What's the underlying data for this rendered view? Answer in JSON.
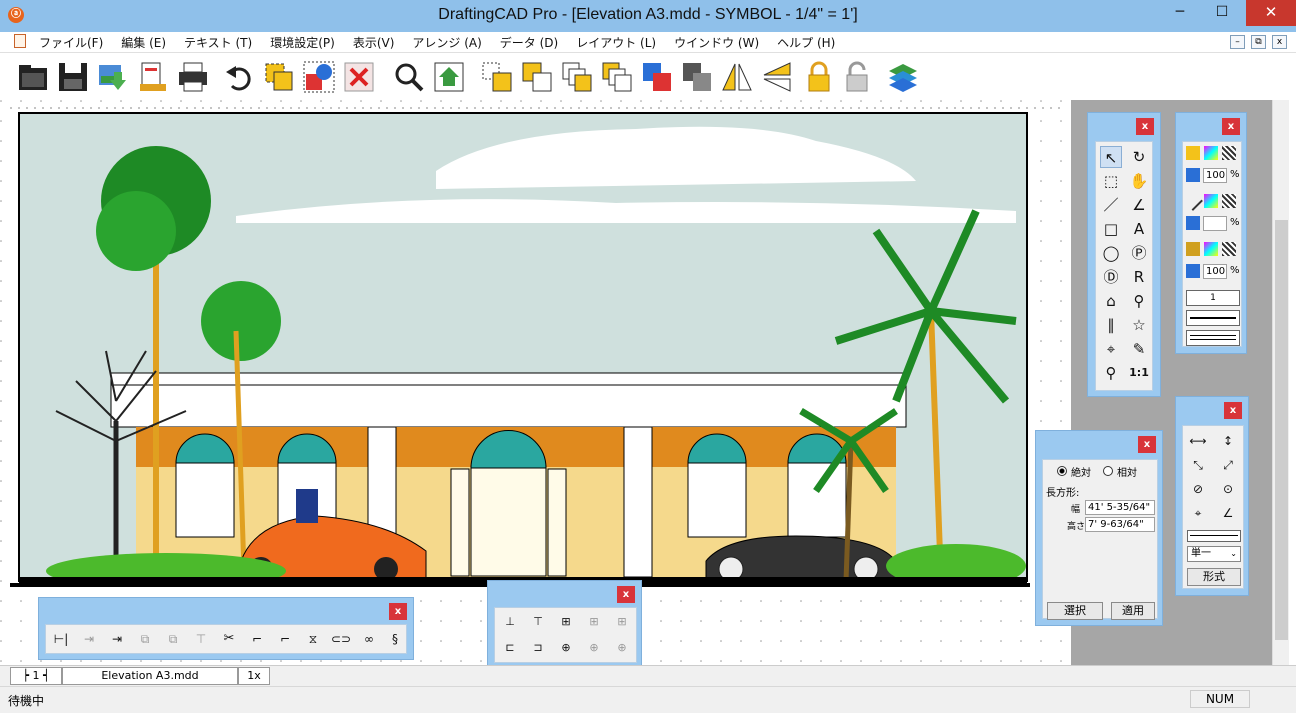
{
  "window": {
    "title": "DraftingCAD Pro - [Elevation A3.mdd - SYMBOL - 1/4\" = 1']",
    "app_icon": "ⓐ",
    "minimize": "─",
    "maximize": "☐",
    "close": "✕"
  },
  "menu": [
    "ファイル(F)",
    "編集 (E)",
    "テキスト (T)",
    "環境設定(P)",
    "表示(V)",
    "アレンジ (A)",
    "データ (D)",
    "レイアウト (L)",
    "ウインドウ (W)",
    "ヘルプ (H)"
  ],
  "mdi": {
    "min": "–",
    "restore": "⧉",
    "close": "x"
  },
  "toolbar_icons": [
    "open-icon",
    "save-icon",
    "export-image-icon",
    "print-preview-icon",
    "print-icon",
    "undo-icon",
    "group-icon",
    "ungroup-icon",
    "delete-icon",
    "zoom-icon",
    "home-view-icon",
    "bring-front-icon",
    "send-back-icon",
    "bring-forward-icon",
    "send-backward-icon",
    "combine-icon",
    "break-icon",
    "flip-horizontal-icon",
    "flip-vertical-icon",
    "lock-icon",
    "unlock-icon",
    "layers-icon"
  ],
  "tool_palette": {
    "close": "x",
    "tools": [
      "↖",
      "↻",
      "⬚",
      "✋",
      "／",
      "∠",
      "□",
      "A",
      "◯",
      "Ⓟ",
      "Ⓓ",
      "R",
      "⌂",
      "⚲",
      "∥",
      "☆",
      "⌖",
      "✎",
      "⚲",
      "1:1"
    ]
  },
  "attr_palette": {
    "close": "x",
    "pct1": "100",
    "pct_sign": "%",
    "pct2": "",
    "pct3": "100",
    "line_number": "1"
  },
  "dim_palette": {
    "close": "x",
    "line_type": "単一",
    "format_button": "形式"
  },
  "coord_palette": {
    "close": "x",
    "radio_absolute": "絶対",
    "radio_relative": "相対",
    "shape_label": "長方形:",
    "width_label": "幅",
    "width_value": "41' 5-35/64\"",
    "height_label": "高さ",
    "height_value": "7' 9-63/64\"",
    "select_button": "選択",
    "apply_button": "適用"
  },
  "edit_palette": {
    "close": "x"
  },
  "align_palette": {
    "close": "x"
  },
  "tabs": {
    "page": "1",
    "file": "Elevation A3.mdd",
    "zoom": "1x"
  },
  "status": {
    "text": "待機中",
    "num": "NUM"
  },
  "colors": {
    "title_bg": "#8fc0ea",
    "palette_bg": "#9bc9f0",
    "close_red": "#d8343a",
    "sky": "#cfe0dd",
    "facade_orange": "#e08a1e",
    "facade_yellow": "#f5d98c",
    "teal": "#2aa7a0"
  }
}
